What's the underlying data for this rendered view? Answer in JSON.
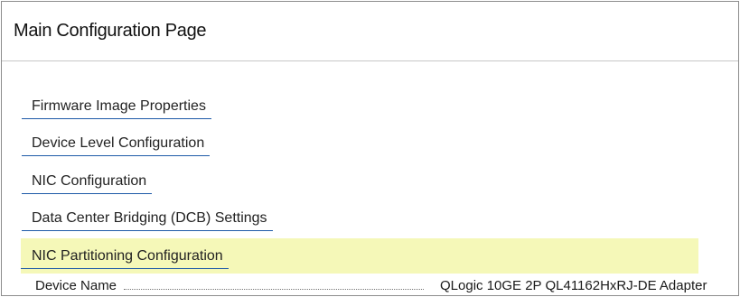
{
  "page": {
    "title": "Main Configuration Page"
  },
  "menu": {
    "items": [
      {
        "label": "Firmware Image Properties"
      },
      {
        "label": "Device Level Configuration"
      },
      {
        "label": "NIC Configuration"
      },
      {
        "label": "Data Center Bridging (DCB) Settings"
      },
      {
        "label": "NIC Partitioning Configuration",
        "selected": true
      }
    ]
  },
  "info": {
    "device_name_label": "Device Name",
    "device_name_value": "QLogic 10GE 2P QL41162HxRJ-DE Adapter"
  },
  "colors": {
    "highlight": "#f5f8b8",
    "link_underline": "#1e5aa8"
  }
}
